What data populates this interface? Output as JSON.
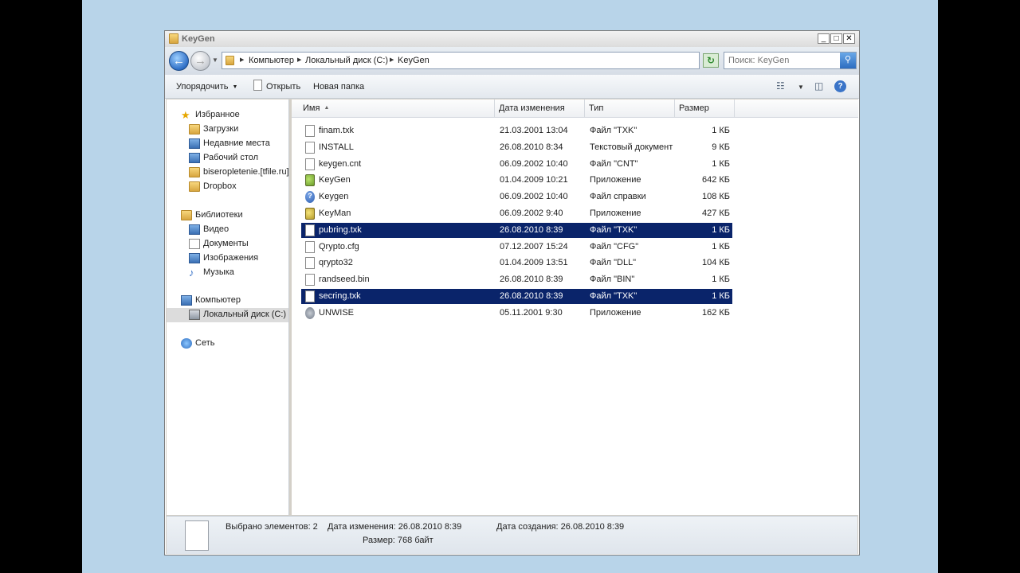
{
  "window": {
    "title": "KeyGen",
    "controls": {
      "minimize": "_",
      "maximize": "□",
      "close": "✕"
    }
  },
  "address": {
    "crumbs": [
      "Компьютер",
      "Локальный диск (C:)",
      "KeyGen"
    ],
    "search_placeholder": "Поиск: KeyGen"
  },
  "toolbar": {
    "organize_label": "Упорядочить",
    "open_label": "Открыть",
    "new_folder_label": "Новая папка"
  },
  "nav": {
    "favorites": {
      "label": "Избранное",
      "items": [
        "Загрузки",
        "Недавние места",
        "Рабочий стол",
        "biseropletenie.[tfile.ru]",
        "Dropbox"
      ]
    },
    "libraries": {
      "label": "Библиотеки",
      "items": [
        "Видео",
        "Документы",
        "Изображения",
        "Музыка"
      ]
    },
    "computer": {
      "label": "Компьютер",
      "items": [
        "Локальный диск (C:)"
      ]
    },
    "network": {
      "label": "Сеть"
    }
  },
  "columns": {
    "name": "Имя",
    "modified": "Дата изменения",
    "type": "Тип",
    "size": "Размер"
  },
  "files": [
    {
      "name": "finam.txk",
      "modified": "21.03.2001 13:04",
      "type": "Файл \"TXK\"",
      "size": "1 КБ",
      "icon": "text-file-icon",
      "selected": false
    },
    {
      "name": "INSTALL",
      "modified": "26.08.2010 8:34",
      "type": "Текстовый документ",
      "size": "9 КБ",
      "icon": "text-file-icon",
      "selected": false
    },
    {
      "name": "keygen.cnt",
      "modified": "06.09.2002 10:40",
      "type": "Файл \"CNT\"",
      "size": "1 КБ",
      "icon": "text-file-icon",
      "selected": false
    },
    {
      "name": "KeyGen",
      "modified": "01.04.2009 10:21",
      "type": "Приложение",
      "size": "642 КБ",
      "icon": "keygen-app-icon",
      "selected": false
    },
    {
      "name": "Keygen",
      "modified": "06.09.2002 10:40",
      "type": "Файл справки",
      "size": "108 КБ",
      "icon": "help-file-icon",
      "selected": false
    },
    {
      "name": "KeyMan",
      "modified": "06.09.2002 9:40",
      "type": "Приложение",
      "size": "427 КБ",
      "icon": "keyman-app-icon",
      "selected": false
    },
    {
      "name": "pubring.txk",
      "modified": "26.08.2010 8:39",
      "type": "Файл \"TXK\"",
      "size": "1 КБ",
      "icon": "text-file-icon",
      "selected": true
    },
    {
      "name": "Qrypto.cfg",
      "modified": "07.12.2007 15:24",
      "type": "Файл \"CFG\"",
      "size": "1 КБ",
      "icon": "text-file-icon",
      "selected": false
    },
    {
      "name": "qrypto32",
      "modified": "01.04.2009 13:51",
      "type": "Файл \"DLL\"",
      "size": "104 КБ",
      "icon": "dll-file-icon",
      "selected": false
    },
    {
      "name": "randseed.bin",
      "modified": "26.08.2010 8:39",
      "type": "Файл \"BIN\"",
      "size": "1 КБ",
      "icon": "text-file-icon",
      "selected": false
    },
    {
      "name": "secring.txk",
      "modified": "26.08.2010 8:39",
      "type": "Файл \"TXK\"",
      "size": "1 КБ",
      "icon": "text-file-icon",
      "selected": true
    },
    {
      "name": "UNWISE",
      "modified": "05.11.2001 9:30",
      "type": "Приложение",
      "size": "162 КБ",
      "icon": "unwise-app-icon",
      "selected": false
    }
  ],
  "details": {
    "selected_count": "Выбрано элементов: 2",
    "modified": "Дата изменения: 26.08.2010 8:39",
    "created": "Дата создания: 26.08.2010 8:39",
    "size": "Размер: 768 байт"
  },
  "colors": {
    "selection": "#0a246a",
    "desktop": "#b8d4e9",
    "frame": "#d4d0c8"
  }
}
